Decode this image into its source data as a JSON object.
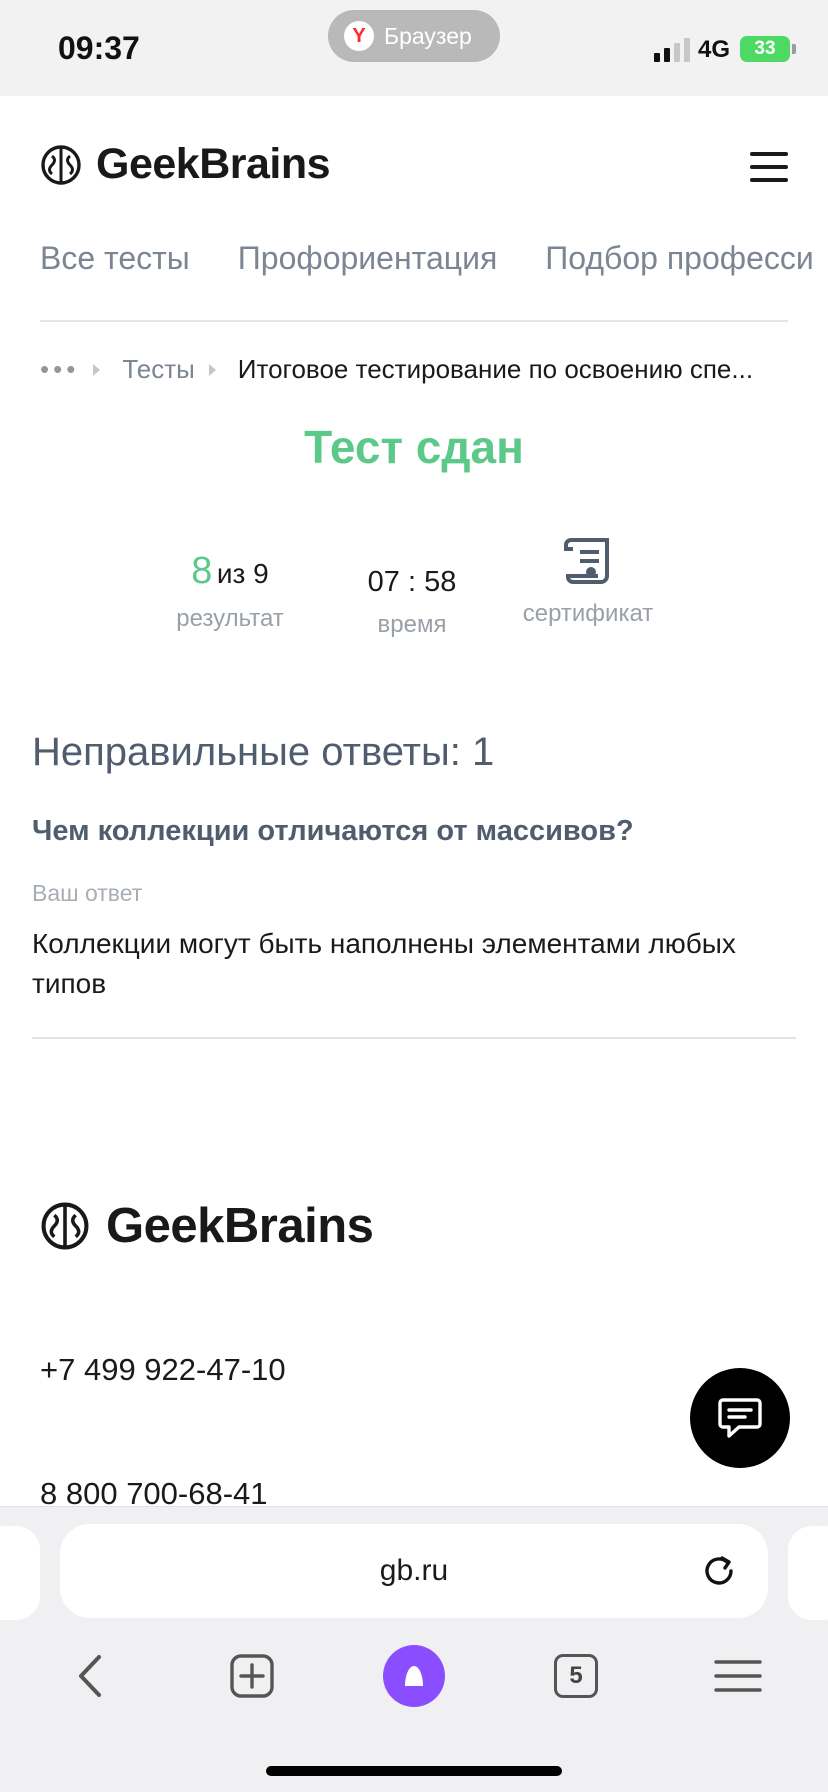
{
  "status_bar": {
    "time": "09:37",
    "browser_label": "Браузер",
    "network": "4G",
    "battery": "33"
  },
  "header": {
    "logo_text": "GeekBrains",
    "menu_icon": "hamburger-icon"
  },
  "tabs": [
    {
      "label": "Все тесты"
    },
    {
      "label": "Профориентация"
    },
    {
      "label": "Подбор професси"
    }
  ],
  "breadcrumb": {
    "dots": "•••",
    "items": [
      {
        "label": "Тесты"
      },
      {
        "label": "Итоговое тестирование по освоению спе..."
      }
    ]
  },
  "result": {
    "title": "Тест сдан",
    "score": "8",
    "score_of": "из 9",
    "score_label": "результат",
    "time": "07 : 58",
    "time_label": "время",
    "certificate_label": "сертификат",
    "certificate_icon": "certificate-scroll-icon"
  },
  "wrong_answers": {
    "heading": "Неправильные ответы: 1",
    "items": [
      {
        "question": "Чем коллекции отличаются от массивов?",
        "your_answer_label": "Ваш ответ",
        "answer": "Коллекции могут быть наполнены элементами любых типов"
      }
    ]
  },
  "footer": {
    "logo_text": "GeekBrains",
    "phones": [
      "+7 499 922-47-10",
      "8 800 700-68-41"
    ]
  },
  "browser": {
    "url": "gb.ru",
    "tab_count": "5"
  },
  "colors": {
    "accent_green": "#5cc98a",
    "heading_slate": "#4f5d6e",
    "alice_purple": "#8a4dff"
  }
}
